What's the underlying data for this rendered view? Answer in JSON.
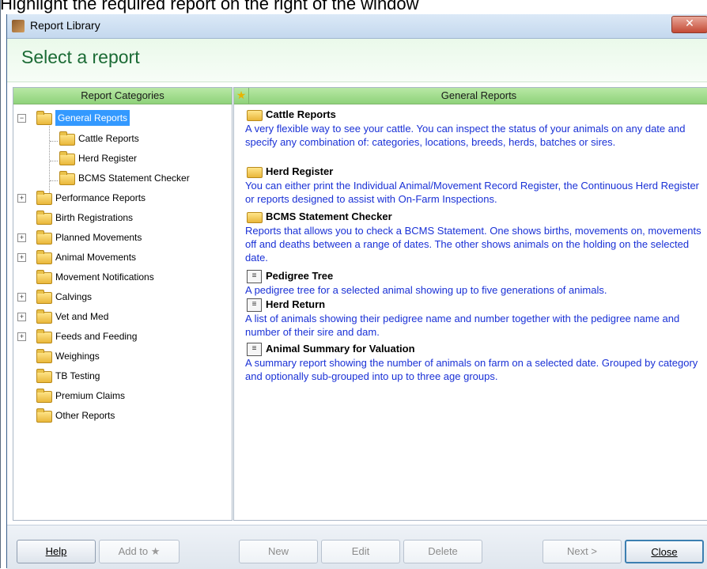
{
  "caption": "Highlight the required report on the right of the window",
  "window": {
    "title": "Report Library",
    "close_icon": "close-icon",
    "header_title": "Select a report"
  },
  "left_panel": {
    "heading": "Report Categories",
    "tree": [
      {
        "label": "General Reports",
        "selected": true,
        "expander": "−",
        "level": 0
      },
      {
        "label": "Cattle Reports",
        "level": 1
      },
      {
        "label": "Herd Register",
        "level": 1
      },
      {
        "label": "BCMS Statement Checker",
        "level": 1
      },
      {
        "label": "Performance Reports",
        "expander": "+",
        "level": 0
      },
      {
        "label": "Birth Registrations",
        "level": 0
      },
      {
        "label": "Planned Movements",
        "expander": "+",
        "level": 0
      },
      {
        "label": "Animal Movements",
        "expander": "+",
        "level": 0
      },
      {
        "label": "Movement Notifications",
        "level": 0
      },
      {
        "label": "Calvings",
        "expander": "+",
        "level": 0
      },
      {
        "label": "Vet and Med",
        "expander": "+",
        "level": 0
      },
      {
        "label": "Feeds and Feeding",
        "expander": "+",
        "level": 0
      },
      {
        "label": "Weighings",
        "level": 0
      },
      {
        "label": "TB Testing",
        "level": 0
      },
      {
        "label": "Premium Claims",
        "level": 0
      },
      {
        "label": "Other Reports",
        "level": 0
      }
    ]
  },
  "right_panel": {
    "star_icon": "star-icon",
    "heading": "General Reports",
    "reports": [
      {
        "icon": "folder-icon",
        "title": "Cattle Reports",
        "description": "A very flexible way to see your cattle. You can inspect the status of your animals on any date and specify any combination of: categories, locations, breeds, herds, batches or sires."
      },
      {
        "icon": "folder-icon",
        "title": "Herd Register",
        "description": "You can either print the Individual Animal/Movement Record Register, the Continuous Herd Register or reports designed to assist with On-Farm Inspections."
      },
      {
        "icon": "folder-icon",
        "title": "BCMS Statement Checker",
        "description": "Reports that allows you to check a BCMS Statement. One shows births, movements on, movements off and deaths between a range of dates. The other shows animals on the holding on the selected date."
      },
      {
        "icon": "report-doc-icon",
        "title": "Pedigree Tree",
        "description": "A pedigree tree for a selected animal showing up to five generations of animals."
      },
      {
        "icon": "report-doc-icon",
        "title": "Herd Return",
        "description": "A list of animals showing their pedigree name and number together with the pedigree name and number of their sire and dam."
      },
      {
        "icon": "report-doc-icon",
        "title": "Animal Summary for Valuation",
        "description": "A summary report showing the number of animals on farm on a selected date. Grouped by category and optionally sub-grouped into up to three age groups."
      }
    ]
  },
  "footer": {
    "help": "Help",
    "add_to": "Add to",
    "new": "New",
    "edit": "Edit",
    "delete": "Delete",
    "next": "Next >",
    "close": "Close"
  }
}
